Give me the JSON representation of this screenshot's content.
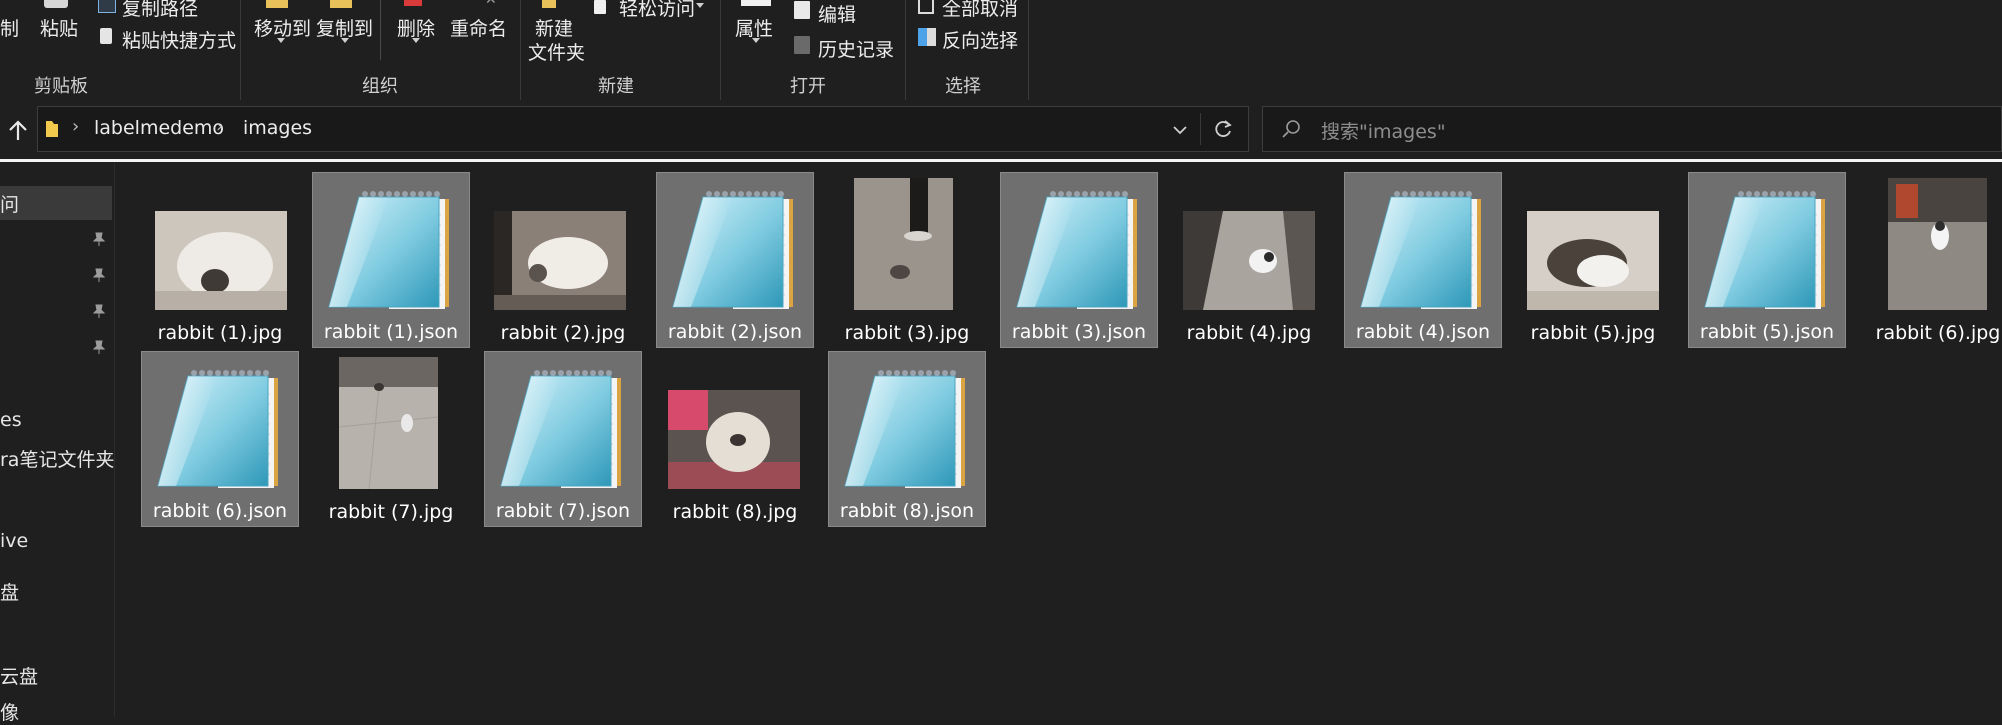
{
  "ribbon": {
    "clipboard": {
      "copy_label": "制",
      "paste_label": "粘贴",
      "copy_path_label": "复制路径",
      "paste_shortcut_label": "粘贴快捷方式",
      "group_label": "剪贴板"
    },
    "organize": {
      "move_to_label": "移动到",
      "copy_to_label": "复制到",
      "delete_label": "删除",
      "rename_label": "重命名",
      "group_label": "组织"
    },
    "new": {
      "new_folder_line1": "新建",
      "new_folder_line2": "文件夹",
      "easy_access_label": "轻松访问",
      "group_label": "新建"
    },
    "open": {
      "properties_label": "属性",
      "edit_label": "编辑",
      "history_label": "历史记录",
      "group_label": "打开"
    },
    "select": {
      "select_none_label": "全部取消",
      "invert_label": "反向选择",
      "group_label": "选择"
    }
  },
  "address": {
    "breadcrumbs": [
      "labelmedemo",
      "images"
    ],
    "search_placeholder": "搜索\"images\""
  },
  "sidebar": {
    "items": [
      "问",
      "es",
      "ra笔记文件夹",
      "ive",
      "盘",
      "云盘",
      "像"
    ]
  },
  "files": [
    {
      "name": "rabbit (1).jpg",
      "type": "jpg"
    },
    {
      "name": "rabbit (1).json",
      "type": "json"
    },
    {
      "name": "rabbit (2).jpg",
      "type": "jpg"
    },
    {
      "name": "rabbit (2).json",
      "type": "json"
    },
    {
      "name": "rabbit (3).jpg",
      "type": "jpg"
    },
    {
      "name": "rabbit (3).json",
      "type": "json"
    },
    {
      "name": "rabbit (4).jpg",
      "type": "jpg"
    },
    {
      "name": "rabbit (4).json",
      "type": "json"
    },
    {
      "name": "rabbit (5).jpg",
      "type": "jpg"
    },
    {
      "name": "rabbit (5).json",
      "type": "json"
    },
    {
      "name": "rabbit (6).jpg",
      "type": "jpg"
    },
    {
      "name": "rabbit (6).json",
      "type": "json"
    },
    {
      "name": "rabbit (7).jpg",
      "type": "jpg"
    },
    {
      "name": "rabbit (7).json",
      "type": "json"
    },
    {
      "name": "rabbit (8).jpg",
      "type": "jpg"
    },
    {
      "name": "rabbit (8).json",
      "type": "json"
    }
  ],
  "colors": {
    "background": "#1f1f1f",
    "selected_tile": "#6f6f6f",
    "folder": "#f2c94c"
  }
}
